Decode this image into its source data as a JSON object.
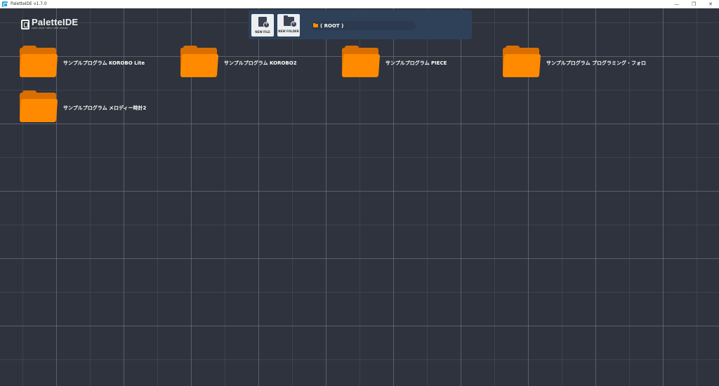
{
  "window": {
    "title": "PaletteIDE v1.7.0",
    "controls": {
      "minimize": "—",
      "restore": "❐",
      "close": "✕"
    }
  },
  "logo": {
    "name": "PaletteIDE",
    "tagline": "cast your idea into shape"
  },
  "toolbar": {
    "new_file_label": "NEW FILE",
    "new_folder_label": "NEW FOLDER",
    "breadcrumb": "( ROOT )"
  },
  "folders": [
    {
      "label": "サンプルプログラム KOROBO Lite"
    },
    {
      "label": "サンプルプログラム KOROBO2"
    },
    {
      "label": "サンプルプログラム PIECE"
    },
    {
      "label": "サンプルプログラム プログラミング・フォロ"
    },
    {
      "label": "サンプルプログラム メロディー時計2"
    }
  ],
  "colors": {
    "folder": "#ff8a00",
    "background": "#2f333d",
    "toolbar": "#2f4158"
  }
}
